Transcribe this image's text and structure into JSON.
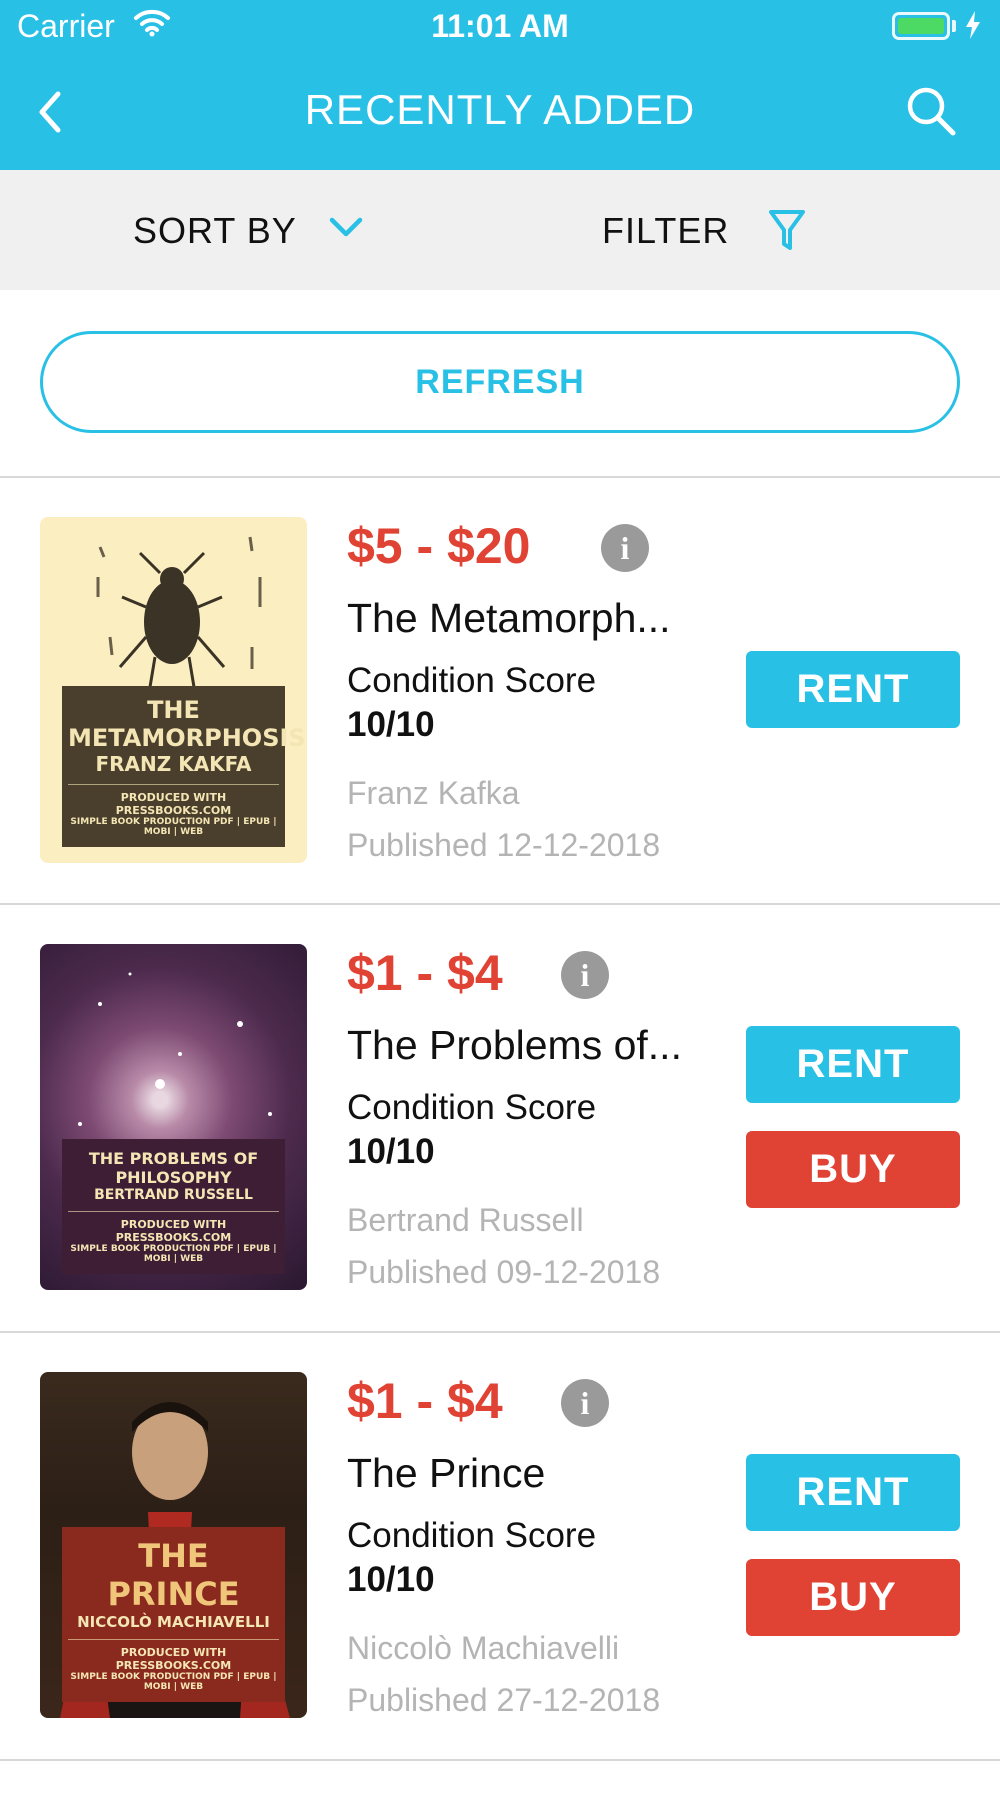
{
  "status_bar": {
    "carrier": "Carrier",
    "time": "11:01 AM",
    "battery_color": "#4cd964"
  },
  "nav": {
    "title": "RECENTLY ADDED",
    "back_icon": "chevron-left-icon",
    "search_icon": "search-icon",
    "background_color": "#29c0e6"
  },
  "toolbar": {
    "sort_label": "SORT BY",
    "filter_label": "FILTER",
    "sort_icon": "chevron-down-icon",
    "filter_icon": "funnel-icon"
  },
  "refresh_label": "REFRESH",
  "books": [
    {
      "price": "$5 - $20",
      "title": "The Metamorph...",
      "condition_label": "Condition Score",
      "condition_value": "10/10",
      "author": "Franz Kafka",
      "published": "Published 12-12-2018",
      "rent_label": "RENT",
      "info_icon": "info-icon",
      "cover": {
        "title": "THE METAMORPHOSIS",
        "author": "FRANZ KAKFA",
        "line1": "PRODUCED WITH PRESSBOOKS.COM",
        "line2": "SIMPLE BOOK PRODUCTION PDF | EPUB | MOBI | WEB"
      }
    },
    {
      "price": "$1 - $4",
      "title": "The Problems of...",
      "condition_label": "Condition Score",
      "condition_value": "10/10",
      "author": "Bertrand Russell",
      "published": "Published 09-12-2018",
      "rent_label": "RENT",
      "buy_label": "BUY",
      "info_icon": "info-icon",
      "cover": {
        "title": "THE PROBLEMS OF PHILOSOPHY",
        "author": "BERTRAND RUSSELL",
        "line1": "PRODUCED WITH PRESSBOOKS.COM",
        "line2": "SIMPLE BOOK PRODUCTION PDF | EPUB | MOBI | WEB"
      }
    },
    {
      "price": "$1 - $4",
      "title": "The Prince",
      "condition_label": "Condition Score",
      "condition_value": "10/10",
      "author": "Niccolò Machiavelli",
      "published": "Published 27-12-2018",
      "rent_label": "RENT",
      "buy_label": "BUY",
      "info_icon": "info-icon",
      "cover": {
        "title": "THE PRINCE",
        "author": "NICCOLÒ MACHIAVELLI",
        "line1": "PRODUCED WITH PRESSBOOKS.COM",
        "line2": "SIMPLE BOOK PRODUCTION PDF | EPUB | MOBI | WEB"
      }
    }
  ],
  "colors": {
    "accent": "#29c0e6",
    "price": "#e04234",
    "buy_button": "#e04234",
    "muted_text": "#b4b4b4"
  }
}
